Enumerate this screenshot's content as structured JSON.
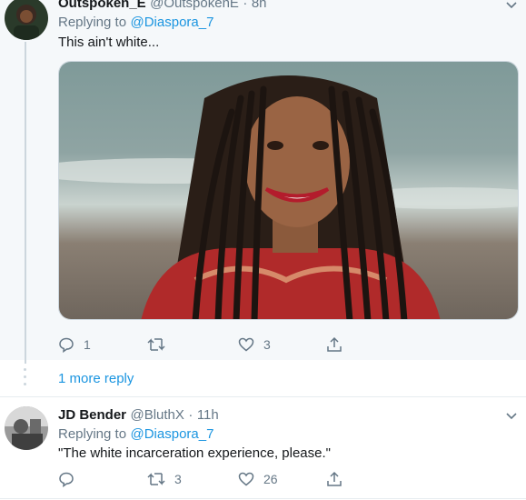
{
  "tweets": [
    {
      "display_name": "Outspoken_E",
      "handle": "@OutspokenE",
      "sep": "·",
      "time": "8h",
      "replying_prefix": "Replying to",
      "replying_to": "@Diaspora_7",
      "text": "This ain't white...",
      "actions": {
        "replies": "1",
        "retweets": "",
        "likes": "3"
      },
      "has_media": true,
      "media_description_icon": "photo-woman-braids"
    },
    {
      "display_name": "JD Bender",
      "handle": "@BluthX",
      "sep": "·",
      "time": "11h",
      "replying_prefix": "Replying to",
      "replying_to": "@Diaspora_7",
      "text": "\"The white incarceration experience, please.\"",
      "actions": {
        "replies": "",
        "retweets": "3",
        "likes": "26"
      }
    }
  ],
  "more_replies": "1 more reply",
  "colors": {
    "link": "#1b95e0",
    "muted": "#657786",
    "highlight_bg": "#f5f8fa",
    "border": "#e6ecf0"
  },
  "icons": [
    "reply-icon",
    "retweet-icon",
    "like-icon",
    "share-icon",
    "chevron-down-icon"
  ]
}
